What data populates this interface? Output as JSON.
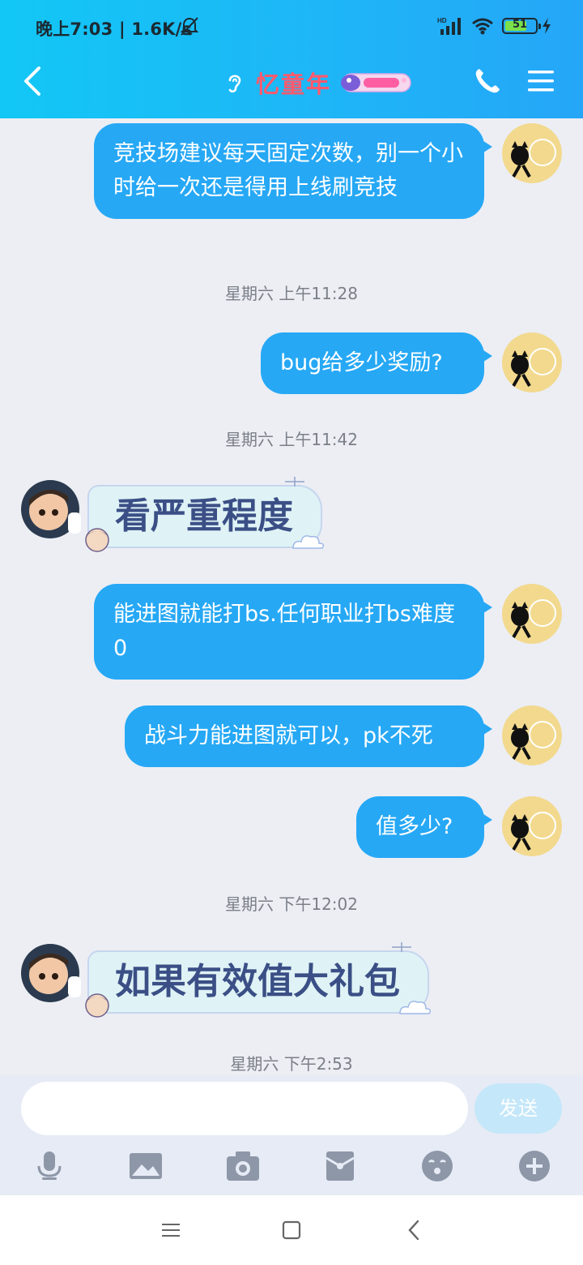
{
  "status_bar": {
    "time": "晚上7:03 | 1.6K/s",
    "battery": "51"
  },
  "header": {
    "title": "忆童年",
    "colors": {
      "bar_start": "#12c7f5",
      "bar_end": "#25a6f7",
      "title": "#ff5a6d"
    }
  },
  "messages": [
    {
      "side": "right",
      "text": "竞技场建议每天固定次数，别一个小时给一次还是得用上线刷竞技"
    },
    {
      "type": "timestamp",
      "text": "星期六 上午11:28"
    },
    {
      "side": "right",
      "text": "bug给多少奖励?"
    },
    {
      "type": "timestamp",
      "text": "星期六 上午11:42"
    },
    {
      "side": "left",
      "text": "看严重程度"
    },
    {
      "side": "right",
      "text": "能进图就能打bs.任何职业打bs难度0"
    },
    {
      "side": "right",
      "text": "战斗力能进图就可以，pk不死"
    },
    {
      "side": "right",
      "text": "值多少?"
    },
    {
      "type": "timestamp",
      "text": "星期六 下午12:02"
    },
    {
      "side": "left",
      "text": "如果有效值大礼包"
    },
    {
      "type": "timestamp",
      "text": "星期六 下午2:53"
    }
  ],
  "input": {
    "value": "",
    "send_label": "发送"
  },
  "toolbar_icons": [
    "microphone-icon",
    "image-icon",
    "camera-icon",
    "red-packet-icon",
    "emoji-icon",
    "plus-icon"
  ],
  "nav_icons": [
    "menu-recents-icon",
    "home-square-icon",
    "back-chevron-icon"
  ],
  "colors": {
    "my_bubble": "#26a8f5",
    "page_bg": "#eceef4"
  }
}
